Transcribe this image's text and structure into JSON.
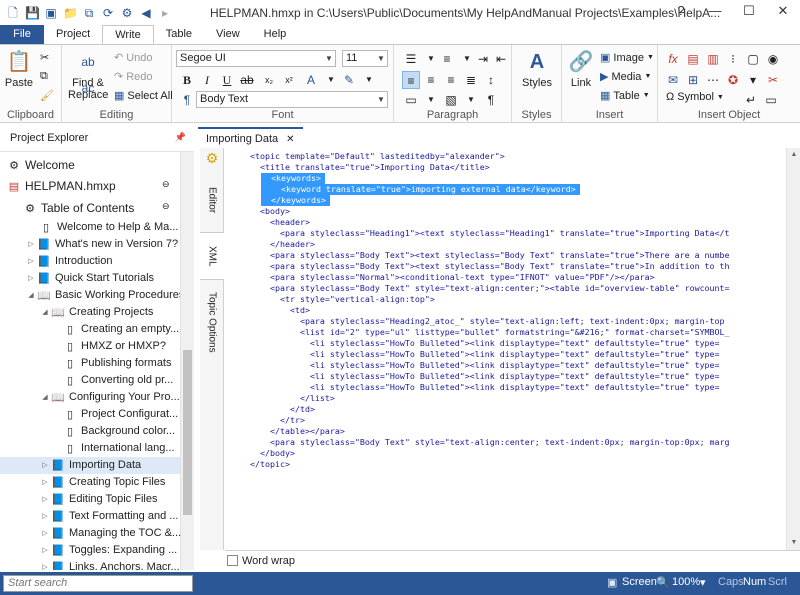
{
  "window": {
    "title": "HELPMAN.hmxp in C:\\Users\\Public\\Documents\\My HelpAndManual Projects\\Examples\\HelpA..."
  },
  "tabs": [
    "File",
    "Project",
    "Write",
    "Table",
    "View",
    "Help"
  ],
  "ribbon": {
    "clipboard": {
      "label": "Clipboard",
      "paste": "Paste"
    },
    "editing": {
      "label": "Editing",
      "find_replace": "Find & Replace",
      "undo": "Undo",
      "redo": "Redo",
      "select_all": "Select All"
    },
    "font": {
      "label": "Font",
      "font_name": "Segoe UI",
      "font_size": "11",
      "style": "Body Text"
    },
    "paragraph": {
      "label": "Paragraph"
    },
    "styles": {
      "label": "Styles",
      "styles": "Styles"
    },
    "insert": {
      "label": "Insert",
      "link": "Link",
      "image": "Image",
      "media": "Media",
      "table": "Table"
    },
    "insert_object": {
      "label": "Insert Object",
      "symbol": "Symbol"
    }
  },
  "project_explorer": {
    "title": "Project Explorer",
    "items": [
      {
        "label": "Welcome"
      },
      {
        "label": "HELPMAN.hmxp"
      },
      {
        "label": "Table of Contents"
      },
      {
        "label": "Welcome to Help & Ma..."
      },
      {
        "label": "What's new in Version 7?"
      },
      {
        "label": "Introduction"
      },
      {
        "label": "Quick Start Tutorials"
      },
      {
        "label": "Basic Working Procedures"
      },
      {
        "label": "Creating Projects"
      },
      {
        "label": "Creating an empty..."
      },
      {
        "label": "HMXZ or HMXP?"
      },
      {
        "label": "Publishing formats"
      },
      {
        "label": "Converting old pr..."
      },
      {
        "label": "Configuring Your Pro..."
      },
      {
        "label": "Project Configurat..."
      },
      {
        "label": "Background color..."
      },
      {
        "label": "International lang..."
      },
      {
        "label": "Importing Data"
      },
      {
        "label": "Creating Topic Files"
      },
      {
        "label": "Editing Topic Files"
      },
      {
        "label": "Text Formatting and ..."
      },
      {
        "label": "Managing the TOC &..."
      },
      {
        "label": "Toggles: Expanding ..."
      },
      {
        "label": "Links, Anchors, Macr..."
      }
    ]
  },
  "document": {
    "tab": "Importing Data",
    "side_tabs": [
      "Editor",
      "XML",
      "Topic Options"
    ],
    "lines": [
      "<topic template=\"Default\" lasteditedby=\"alexander\">",
      "  <title translate=\"true\">Importing Data</title>",
      "  <keywords>",
      "    <keyword translate=\"true\">importing external data</keyword>",
      "  </keywords>",
      "  <body>",
      "    <header>",
      "      <para styleclass=\"Heading1\"><text styleclass=\"Heading1\" translate=\"true\">Importing Data</t",
      "    </header>",
      "    <para styleclass=\"Body Text\"><text styleclass=\"Body Text\" translate=\"true\">There are a numbe",
      "    <para styleclass=\"Body Text\"><text styleclass=\"Body Text\" translate=\"true\">In addition to th",
      "    <para styleclass=\"Normal\"><conditional-text type=\"IFNOT\" value=\"PDF\"/></para>",
      "    <para styleclass=\"Body Text\" style=\"text-align:center;\"><table id=\"overview-table\" rowcount=",
      "      <tr style=\"vertical-align:top\">",
      "        <td>",
      "          <para styleclass=\"Heading2_atoc_\" style=\"text-align:left; text-indent:0px; margin-top",
      "          <list id=\"2\" type=\"ul\" listtype=\"bullet\" formatstring=\"&#216;\" format-charset=\"SYMBOL_",
      "            <li styleclass=\"HowTo Bulleted\"><link displaytype=\"text\" defaultstyle=\"true\" type=",
      "            <li styleclass=\"HowTo Bulleted\"><link displaytype=\"text\" defaultstyle=\"true\" type=",
      "            <li styleclass=\"HowTo Bulleted\"><link displaytype=\"text\" defaultstyle=\"true\" type=",
      "            <li styleclass=\"HowTo Bulleted\"><link displaytype=\"text\" defaultstyle=\"true\" type=",
      "            <li styleclass=\"HowTo Bulleted\"><link displaytype=\"text\" defaultstyle=\"true\" type=",
      "          </list>",
      "        </td>",
      "      </tr>",
      "    </table></para>",
      "    <para styleclass=\"Body Text\" style=\"text-align:center; text-indent:0px; margin-top:0px; marg",
      "  </body>",
      "</topic>"
    ],
    "word_wrap": "Word wrap"
  },
  "status": {
    "search_placeholder": "Start search",
    "mode": "Screen",
    "zoom": "100%",
    "caps": "Caps",
    "num": "Num",
    "scroll": "Scrl"
  }
}
